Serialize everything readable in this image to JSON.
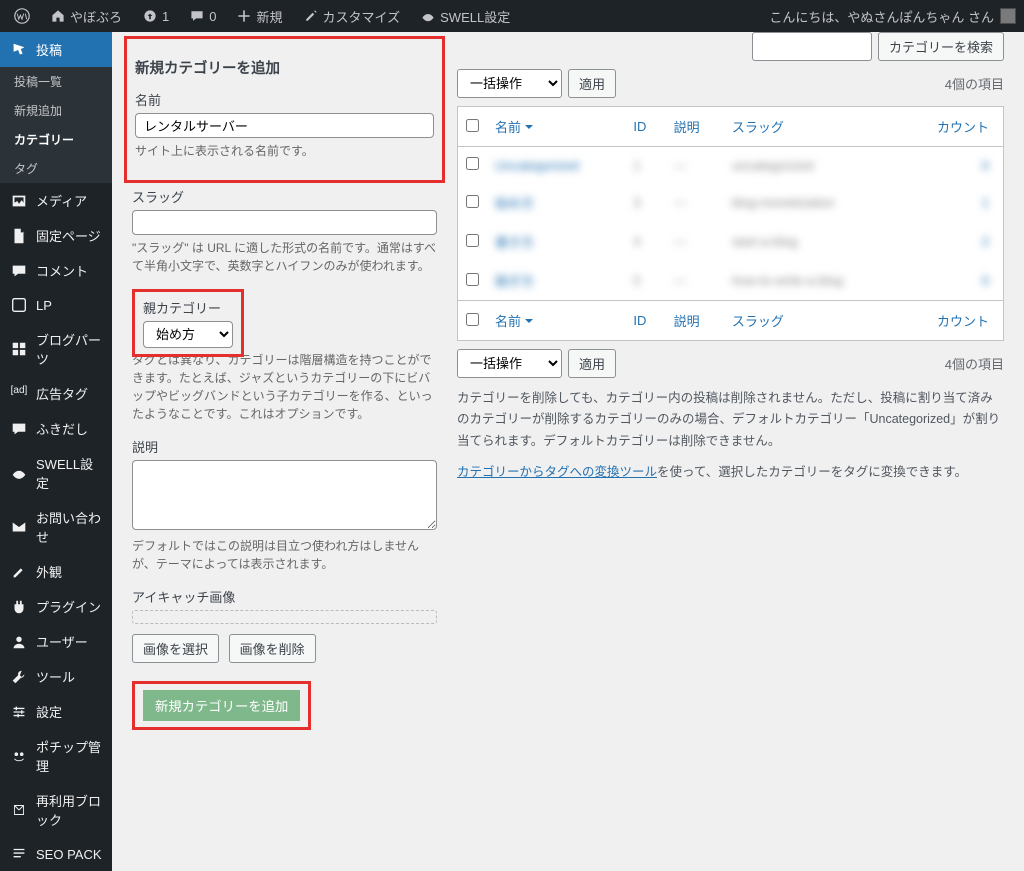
{
  "toolbar": {
    "site_name": "やぼぶろ",
    "updates_count": "1",
    "comments_count": "0",
    "new_label": "新規",
    "customize_label": "カスタマイズ",
    "swell_label": "SWELL設定",
    "greeting": "こんにちは、やぬさんぽんちゃん さん"
  },
  "sidebar": {
    "posts": "投稿",
    "sub_all": "投稿一覧",
    "sub_new": "新規追加",
    "sub_cat": "カテゴリー",
    "sub_tag": "タグ",
    "media": "メディア",
    "pages": "固定ページ",
    "comments": "コメント",
    "lp": "LP",
    "blogparts": "ブログパーツ",
    "adtag": "広告タグ",
    "fukidashi": "ふきだし",
    "swell": "SWELL設定",
    "contact": "お問い合わせ",
    "appearance": "外観",
    "plugins": "プラグイン",
    "users": "ユーザー",
    "tools": "ツール",
    "settings": "設定",
    "pochipp": "ポチップ管理",
    "reusable": "再利用ブロック",
    "seopack": "SEO PACK"
  },
  "form": {
    "heading": "新規カテゴリーを追加",
    "name_label": "名前",
    "name_value": "レンタルサーバー",
    "name_desc": "サイト上に表示される名前です。",
    "slug_label": "スラッグ",
    "slug_value": "",
    "slug_desc": "\"スラッグ\" は URL に適した形式の名前です。通常はすべて半角小文字で、英数字とハイフンのみが使われます。",
    "parent_label": "親カテゴリー",
    "parent_value": "始め方",
    "parent_desc": "タグとは異なり、カテゴリーは階層構造を持つことができます。たとえば、ジャズというカテゴリーの下にビバップやビッグバンドという子カテゴリーを作る、といったようなことです。これはオプションです。",
    "desc_label": "説明",
    "desc_value": "",
    "desc_desc": "デフォルトではこの説明は目立つ使われ方はしませんが、テーマによっては表示されます。",
    "eyecatch_label": "アイキャッチ画像",
    "eyecatch_select": "画像を選択",
    "eyecatch_remove": "画像を削除",
    "submit": "新規カテゴリーを追加"
  },
  "list": {
    "search_btn": "カテゴリーを検索",
    "bulk": "一括操作",
    "apply": "適用",
    "count_text": "4個の項目",
    "cols": {
      "name": "名前",
      "id": "ID",
      "desc": "説明",
      "slug": "スラッグ",
      "count": "カウント"
    },
    "rows": [
      {
        "name": "Uncategorized",
        "id": "1",
        "desc": "—",
        "slug": "uncategorized",
        "count": "0"
      },
      {
        "name": "始め方",
        "id": "3",
        "desc": "—",
        "slug": "blog-monetization",
        "count": "1"
      },
      {
        "name": "書き方",
        "id": "4",
        "desc": "—",
        "slug": "start-a-blog",
        "count": "2"
      },
      {
        "name": "稼ぎ方",
        "id": "5",
        "desc": "—",
        "slug": "how-to-write-a-blog",
        "count": "0"
      }
    ],
    "note1": "カテゴリーを削除しても、カテゴリー内の投稿は削除されません。ただし、投稿に割り当て済みのカテゴリーが削除するカテゴリーのみの場合、デフォルトカテゴリー「Uncategorized」が割り当てられます。デフォルトカテゴリーは削除できません。",
    "note2a": "カテゴリーからタグへの変換ツール",
    "note2b": "を使って、選択したカテゴリーをタグに変換できます。"
  }
}
